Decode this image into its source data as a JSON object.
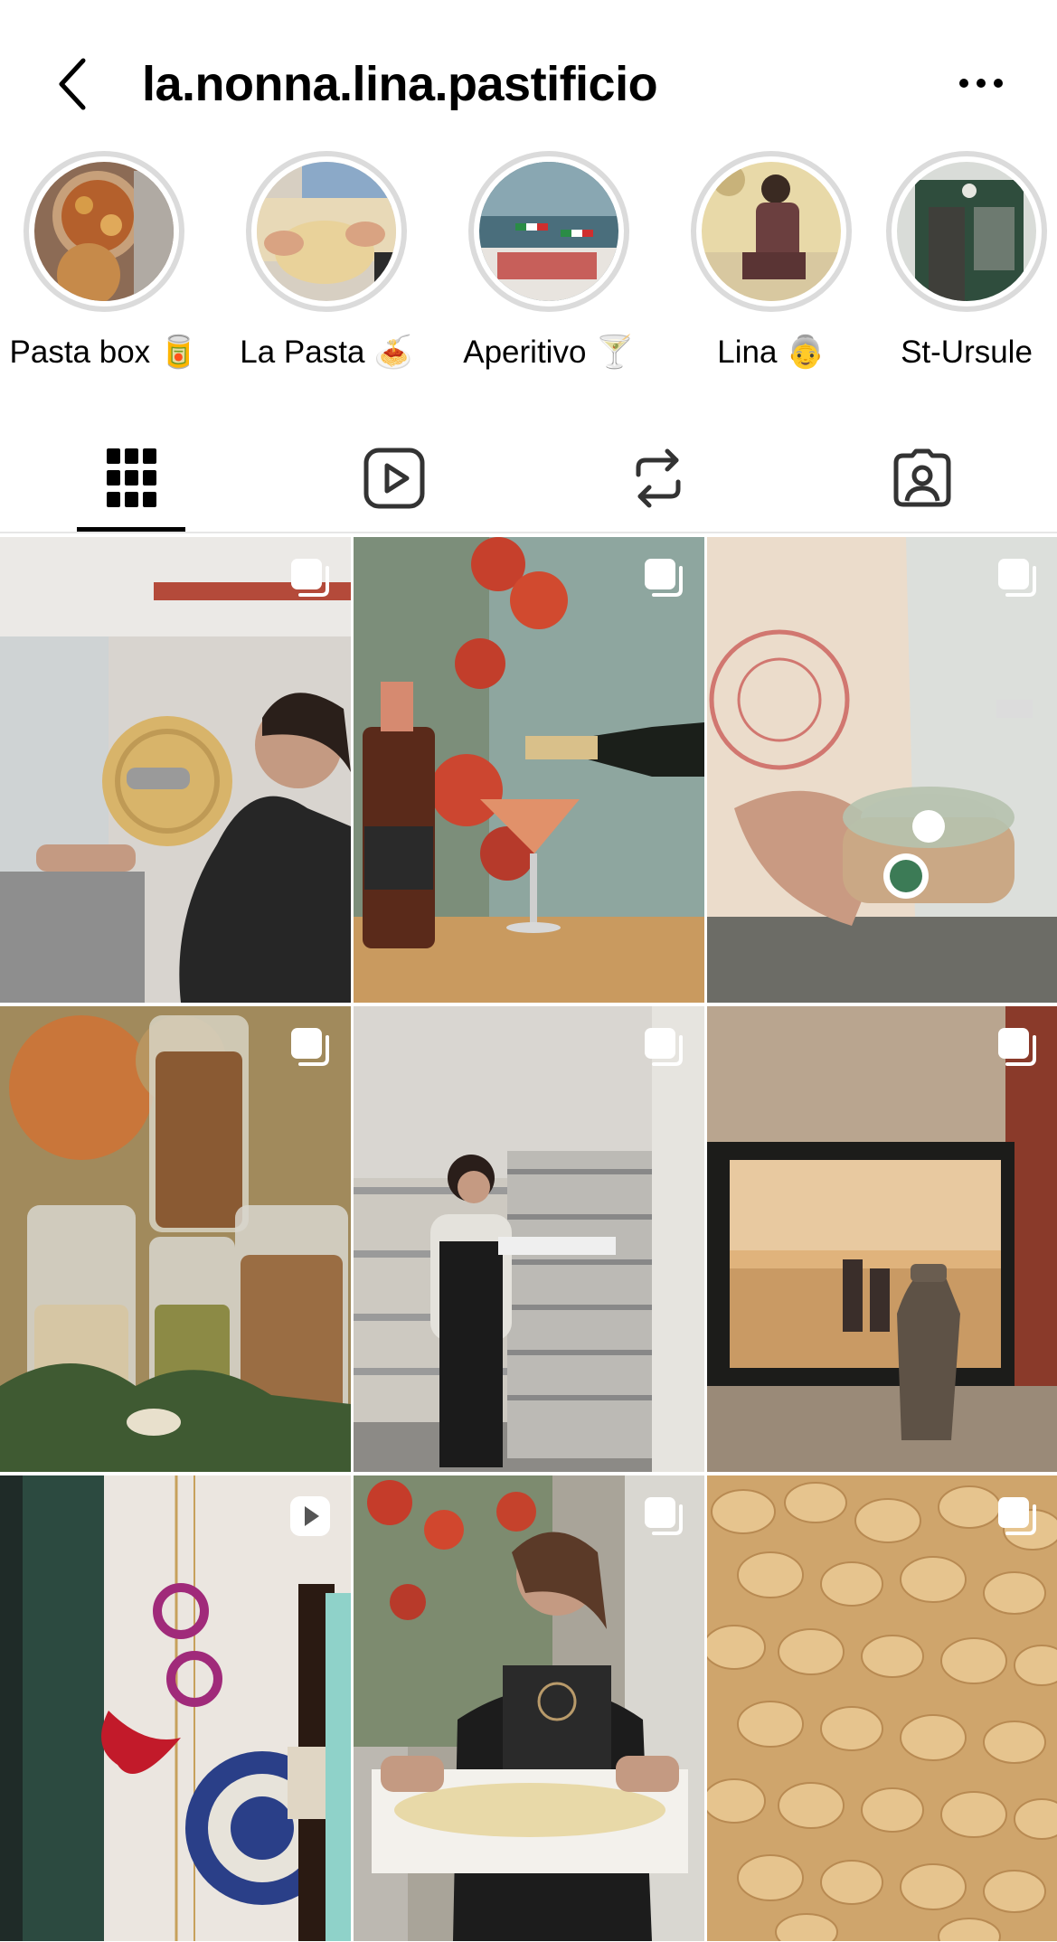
{
  "header": {
    "title": "la.nonna.lina.pastificio",
    "back_icon": "chevron-left-icon",
    "more_icon": "more-horizontal-icon"
  },
  "highlights": [
    {
      "label": "Pasta box 🥫",
      "image": "pasta-box-photo"
    },
    {
      "label": "La Pasta 🍝",
      "image": "fresh-pasta-photo"
    },
    {
      "label": "Aperitivo 🍸",
      "image": "aperitivo-table-photo"
    },
    {
      "label": "Lina 👵",
      "image": "lina-portrait-photo"
    },
    {
      "label": "St-Ursule",
      "image": "storefront-photo"
    }
  ],
  "tabs": [
    {
      "name": "grid",
      "icon": "grid-icon",
      "active": true
    },
    {
      "name": "reels",
      "icon": "reels-icon",
      "active": false
    },
    {
      "name": "reposts",
      "icon": "repost-icon",
      "active": false
    },
    {
      "name": "tagged",
      "icon": "tagged-person-icon",
      "active": false
    }
  ],
  "posts": [
    {
      "subject": "pasta-machine-photo",
      "type": "carousel"
    },
    {
      "subject": "spritz-pour-photo",
      "type": "carousel"
    },
    {
      "subject": "pasta-bowl-takeaway-photo",
      "type": "carousel"
    },
    {
      "subject": "jars-of-nuts-photo",
      "type": "carousel"
    },
    {
      "subject": "baker-with-tray-photo",
      "type": "carousel"
    },
    {
      "subject": "framed-photo-photo",
      "type": "carousel"
    },
    {
      "subject": "carnival-mask-photo",
      "type": "reel"
    },
    {
      "subject": "pasta-tray-photo",
      "type": "carousel"
    },
    {
      "subject": "tortellini-photo",
      "type": "carousel"
    }
  ],
  "colors": {
    "ring": "#dbdbdb",
    "divider": "#e6e6e6",
    "text": "#000000"
  }
}
